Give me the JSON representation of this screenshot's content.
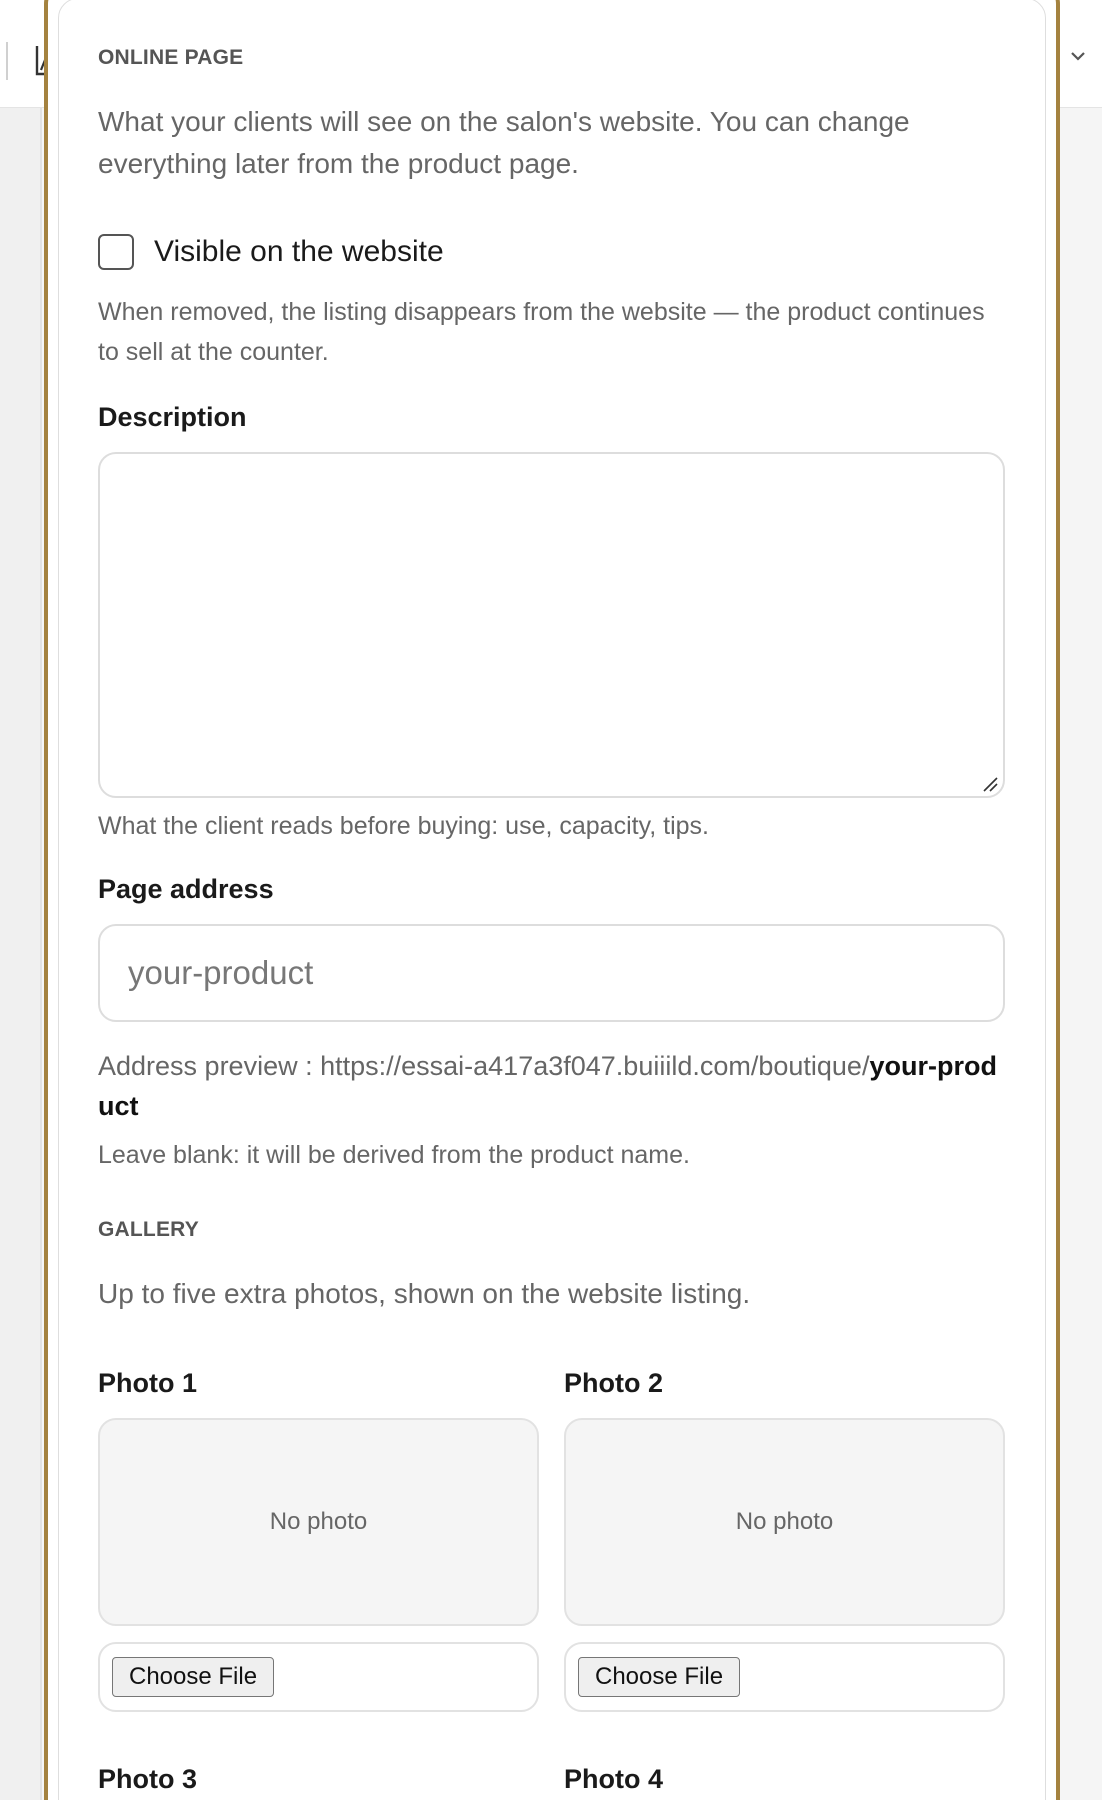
{
  "online_page": {
    "eyebrow": "ONLINE PAGE",
    "lead": "What your clients will see on the salon's website. You can change everything later from the product page.",
    "visible_label": "Visible on the website",
    "visible_checked": false,
    "visible_hint": "When removed, the listing disappears from the website — the product continues to sell at the counter.",
    "description_label": "Description",
    "description_value": "",
    "description_hint": "What the client reads before buying: use, capacity, tips.",
    "page_address_label": "Page address",
    "page_address_placeholder": "your-product",
    "preview_prefix": "Address preview : https://essai-a417a3f047.buiiild.com/boutique/",
    "preview_slug": "your-product",
    "blank_hint": "Leave blank: it will be derived from the product name."
  },
  "gallery": {
    "eyebrow": "GALLERY",
    "lead": "Up to five extra photos, shown on the website listing.",
    "photos": [
      {
        "label": "Photo 1",
        "empty_text": "No photo",
        "button": "Choose File"
      },
      {
        "label": "Photo 2",
        "empty_text": "No photo",
        "button": "Choose File"
      },
      {
        "label": "Photo 3"
      },
      {
        "label": "Photo 4"
      }
    ]
  },
  "colors": {
    "panel_border": "#a4823f",
    "muted_text": "#666666",
    "input_border": "#dddddd"
  },
  "icons": [
    "chart-icon",
    "chevron-down-icon",
    "resize-grip-icon"
  ]
}
